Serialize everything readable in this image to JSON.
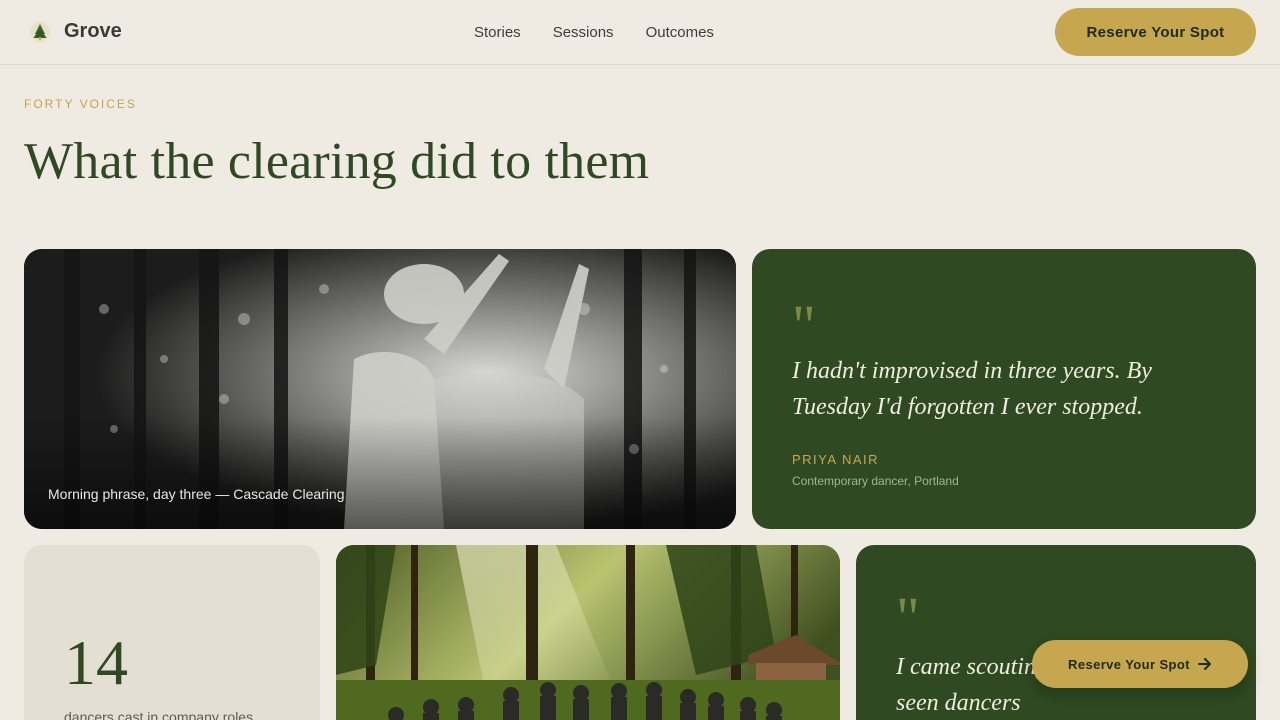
{
  "header": {
    "brand": "Grove",
    "nav": [
      "Stories",
      "Sessions",
      "Outcomes"
    ],
    "cta_label": "Reserve Your Spot"
  },
  "hero": {
    "eyebrow": "FORTY VOICES",
    "headline": "What the clearing did to them"
  },
  "cards": {
    "dancer_photo_caption": "Morning phrase, day three — Cascade Clearing",
    "quote1": {
      "mark": "\"",
      "text": "I hadn't improvised in three years. By Tuesday I'd forgotten I ever stopped.",
      "name": "PRIYA NAIR",
      "role": "Contemporary dancer, Portland"
    },
    "stat": {
      "number": "14",
      "label": "dancers cast in company roles"
    },
    "quote2": {
      "mark": "\"",
      "text": "I came scouting because I'd never seen dancers"
    }
  },
  "floating_cta": {
    "label": "Reserve Your Spot",
    "icon": "arrow-right-icon"
  },
  "colors": {
    "background": "#f0ebe2",
    "forest": "#2f4a22",
    "gold": "#c6a750"
  }
}
